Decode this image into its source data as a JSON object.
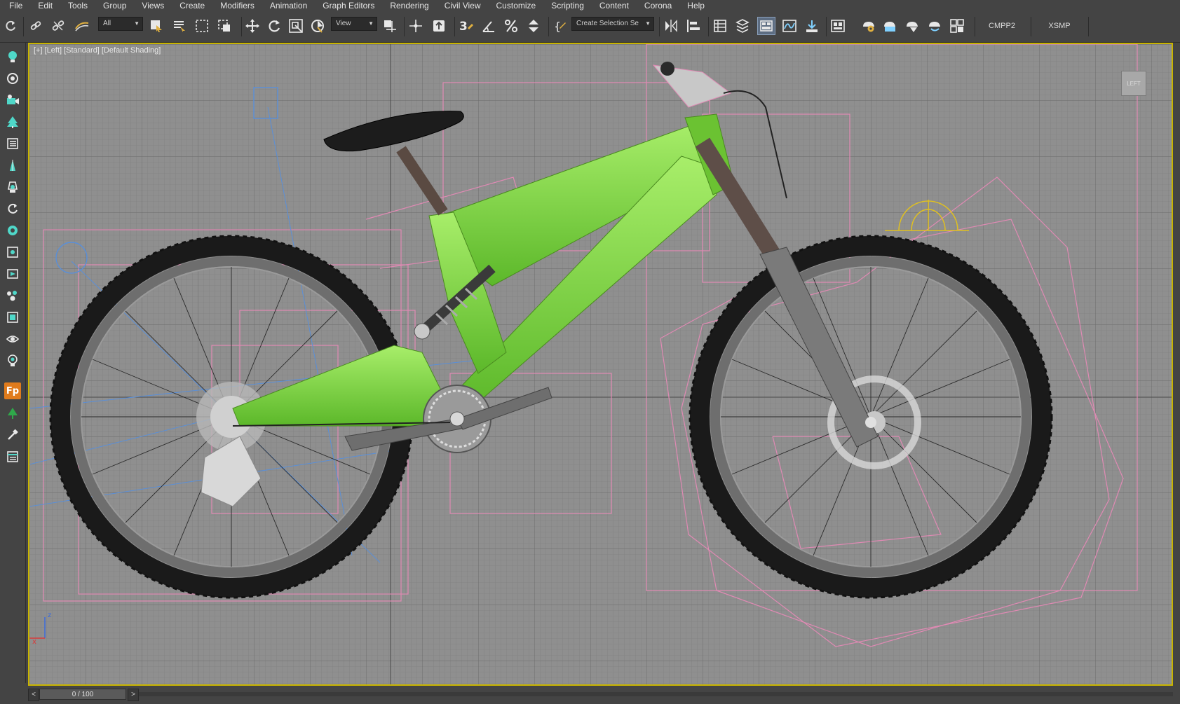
{
  "menu": [
    "File",
    "Edit",
    "Tools",
    "Group",
    "Views",
    "Create",
    "Modifiers",
    "Animation",
    "Graph Editors",
    "Rendering",
    "Civil View",
    "Customize",
    "Scripting",
    "Content",
    "Corona",
    "Help"
  ],
  "toolbar": {
    "selection_filter": "All",
    "reference_coord": "View",
    "snap_angle_label": "3",
    "selection_set_placeholder": "Create Selection Se",
    "workspace_1": "CMPP2",
    "workspace_2": "XSMP"
  },
  "viewport": {
    "label": "[+] [Left] [Standard] [Default Shading]",
    "viewcube_label": "LEFT",
    "axis_x": "x",
    "axis_z": "z"
  },
  "command_panel": {
    "fp_label": "Fp"
  },
  "timeline": {
    "frame_display": "0 / 100",
    "prev": "<",
    "next": ">"
  },
  "colors": {
    "background": "#444444",
    "viewport_bg": "#8f8f8f",
    "viewport_border": "#c8b400",
    "frame_green": "#7ed43c",
    "helper_pink": "#e08ab4",
    "helper_blue": "#5a8fd8"
  }
}
